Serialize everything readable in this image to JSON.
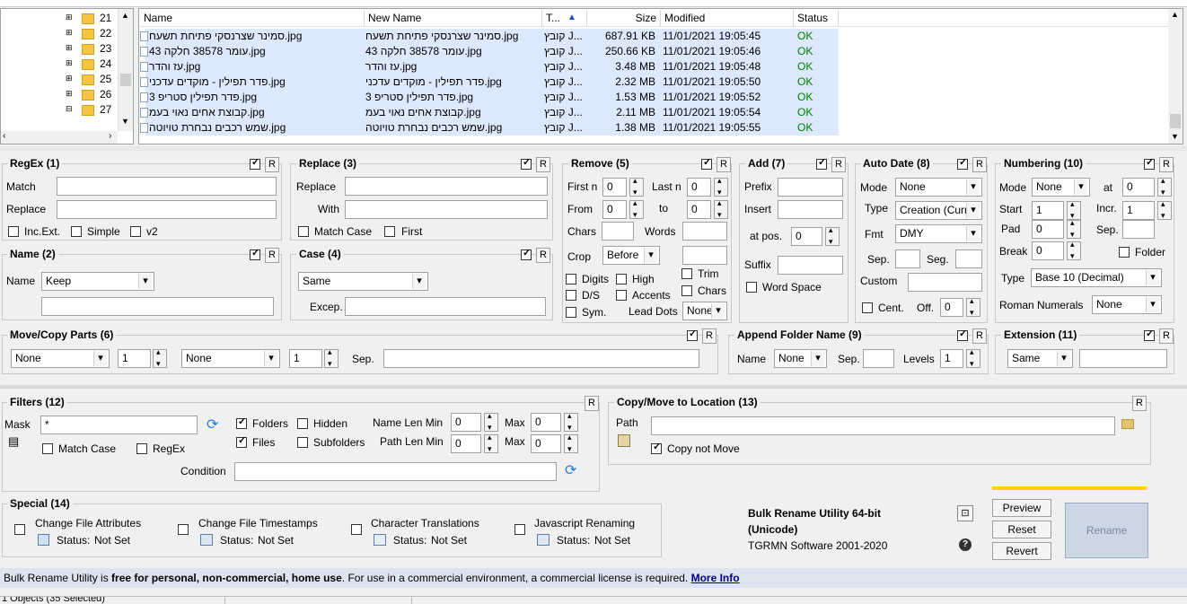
{
  "tree": {
    "items": [
      "21",
      "22",
      "23",
      "24",
      "25",
      "26",
      "27"
    ]
  },
  "file_list": {
    "columns": [
      "Name",
      "New Name",
      "T...",
      "Size",
      "Modified",
      "Status"
    ],
    "rows": [
      {
        "name": "סמינר שצרנסקי פתיחת תשעח.jpg",
        "new_name": "סמינר שצרנסקי פתיחת תשעח.jpg",
        "type": "קובץ J...",
        "size": "687.91 KB",
        "modified": "11/01/2021 19:05:45",
        "status": "OK"
      },
      {
        "name": "עומר 38578 חלקה 43.jpg",
        "new_name": "עומר 38578 חלקה 43.jpg",
        "type": "קובץ J...",
        "size": "250.66 KB",
        "modified": "11/01/2021 19:05:46",
        "status": "OK"
      },
      {
        "name": "עז והדר.jpg",
        "new_name": "עז והדר.jpg",
        "type": "קובץ J...",
        "size": "3.48 MB",
        "modified": "11/01/2021 19:05:48",
        "status": "OK"
      },
      {
        "name": "פדר תפילין - מוקדים עדכני.jpg",
        "new_name": "פדר תפילין - מוקדים עדכני.jpg",
        "type": "קובץ J...",
        "size": "2.32 MB",
        "modified": "11/01/2021 19:05:50",
        "status": "OK"
      },
      {
        "name": "פדר תפילין סטריפ 3.jpg",
        "new_name": "פדר תפילין סטריפ 3.jpg",
        "type": "קובץ J...",
        "size": "1.53 MB",
        "modified": "11/01/2021 19:05:52",
        "status": "OK"
      },
      {
        "name": "קבוצת אחים נאוי בעמ.jpg",
        "new_name": "קבוצת אחים נאוי בעמ.jpg",
        "type": "קובץ J...",
        "size": "2.11 MB",
        "modified": "11/01/2021 19:05:54",
        "status": "OK"
      },
      {
        "name": "שמש רכבים נבחרת טויוטה.jpg",
        "new_name": "שמש רכבים נבחרת טויוטה.jpg",
        "type": "קובץ J...",
        "size": "1.38 MB",
        "modified": "11/01/2021 19:05:55",
        "status": "OK"
      }
    ]
  },
  "regex": {
    "title": "RegEx (1)",
    "match": "Match",
    "replace": "Replace",
    "incext": "Inc.Ext.",
    "simple": "Simple",
    "v2": "v2"
  },
  "replace": {
    "title": "Replace (3)",
    "replace": "Replace",
    "with": "With",
    "matchcase": "Match Case",
    "first": "First"
  },
  "remove": {
    "title": "Remove (5)",
    "firstn": "First n",
    "firstn_val": "0",
    "lastn": "Last n",
    "lastn_val": "0",
    "from": "From",
    "from_val": "0",
    "to": "to",
    "to_val": "0",
    "chars": "Chars",
    "words": "Words",
    "crop": "Crop",
    "crop_val": "Before",
    "digits": "Digits",
    "high": "High",
    "trim": "Trim",
    "ds": "D/S",
    "accents": "Accents",
    "chars2": "Chars",
    "sym": "Sym.",
    "leaddots": "Lead Dots",
    "leaddots_val": "None"
  },
  "add": {
    "title": "Add (7)",
    "prefix": "Prefix",
    "insert": "Insert",
    "atpos": "at pos.",
    "atpos_val": "0",
    "suffix": "Suffix",
    "wordspace": "Word Space"
  },
  "autodate": {
    "title": "Auto Date (8)",
    "mode": "Mode",
    "mode_val": "None",
    "type": "Type",
    "type_val": "Creation (Curr",
    "fmt": "Fmt",
    "fmt_val": "DMY",
    "sep": "Sep.",
    "seg": "Seg.",
    "custom": "Custom",
    "cent": "Cent.",
    "off": "Off.",
    "off_val": "0"
  },
  "numbering": {
    "title": "Numbering (10)",
    "mode": "Mode",
    "mode_val": "None",
    "at": "at",
    "at_val": "0",
    "start": "Start",
    "start_val": "1",
    "incr": "Incr.",
    "incr_val": "1",
    "pad": "Pad",
    "pad_val": "0",
    "sep": "Sep.",
    "break": "Break",
    "break_val": "0",
    "folder": "Folder",
    "type": "Type",
    "type_val": "Base 10 (Decimal)",
    "roman": "Roman Numerals",
    "roman_val": "None"
  },
  "name": {
    "title": "Name (2)",
    "name": "Name",
    "name_val": "Keep"
  },
  "case": {
    "title": "Case (4)",
    "case_val": "Same",
    "excep": "Excep."
  },
  "movecopy": {
    "title": "Move/Copy Parts (6)",
    "sel1": "None",
    "num1": "1",
    "sel2": "None",
    "num2": "1",
    "sep": "Sep."
  },
  "appendfolder": {
    "title": "Append Folder Name (9)",
    "name": "Name",
    "name_val": "None",
    "sep": "Sep.",
    "levels": "Levels",
    "levels_val": "1"
  },
  "extension": {
    "title": "Extension (11)",
    "val": "Same"
  },
  "filters": {
    "title": "Filters (12)",
    "mask": "Mask",
    "mask_val": "*",
    "folders": "Folders",
    "hidden": "Hidden",
    "files": "Files",
    "subfolders": "Subfolders",
    "namelenmin": "Name Len Min",
    "namelenmin_val": "0",
    "max": "Max",
    "max_val": "0",
    "pathlenmin": "Path Len Min",
    "pathlenmin_val": "0",
    "max2": "Max",
    "max2_val": "0",
    "matchcase": "Match Case",
    "regex": "RegEx",
    "condition": "Condition"
  },
  "copymove": {
    "title": "Copy/Move to Location (13)",
    "path": "Path",
    "copynotmove": "Copy not Move"
  },
  "special": {
    "title": "Special (14)",
    "items": [
      {
        "label": "Change File Attributes",
        "status_label": "Status:",
        "status": "Not Set"
      },
      {
        "label": "Change File Timestamps",
        "status_label": "Status:",
        "status": "Not Set"
      },
      {
        "label": "Character Translations",
        "status_label": "Status:",
        "status": "Not Set"
      },
      {
        "label": "Javascript Renaming",
        "status_label": "Status:",
        "status": "Not Set"
      }
    ]
  },
  "app": {
    "name1": "Bulk Rename Utility 64-bit",
    "name2": "(Unicode)",
    "company": "TGRMN Software 2001-2020"
  },
  "buttons": {
    "preview": "Preview",
    "reset": "Reset",
    "revert": "Revert",
    "rename": "Rename",
    "r": "R"
  },
  "footer": {
    "t1": "Bulk Rename Utility is ",
    "t2": "free for personal, non-commercial, home use",
    "t3": ". For use in a commercial environment, a commercial license is required. ",
    "link": "More Info"
  },
  "statusbar": {
    "text": "1 Objects (35 Selected)"
  },
  "colors": {
    "selection": "#dce8fb",
    "accent": "#ffd200",
    "footer_bg": "#dde4ef",
    "link": "#000080"
  }
}
